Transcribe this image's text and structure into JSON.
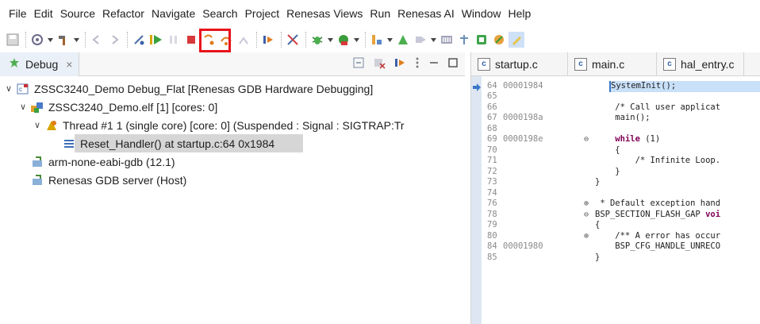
{
  "menu": [
    "File",
    "Edit",
    "Source",
    "Refactor",
    "Navigate",
    "Search",
    "Project",
    "Renesas Views",
    "Run",
    "Renesas AI",
    "Window",
    "Help"
  ],
  "debug": {
    "tab_label": "Debug",
    "tab_close": "×",
    "tree": [
      {
        "level": 0,
        "twisty": "∨",
        "icon": "launch-config-icon",
        "label": "ZSSC3240_Demo Debug_Flat [Renesas GDB Hardware Debugging]"
      },
      {
        "level": 1,
        "twisty": "∨",
        "icon": "elf-process-icon",
        "label": "ZSSC3240_Demo.elf [1] [cores: 0]"
      },
      {
        "level": 2,
        "twisty": "∨",
        "icon": "thread-suspended-icon",
        "label": "Thread #1 1 (single core) [core: 0] (Suspended : Signal : SIGTRAP:Tr"
      },
      {
        "level": 3,
        "twisty": "",
        "icon": "stack-frame-icon",
        "label": "Reset_Handler() at startup.c:64 0x1984",
        "selected": true
      },
      {
        "level": 1,
        "twisty": "",
        "icon": "gdb-process-icon",
        "label": "arm-none-eabi-gdb (12.1)"
      },
      {
        "level": 1,
        "twisty": "",
        "icon": "gdb-server-icon",
        "label": "Renesas GDB server (Host)"
      }
    ]
  },
  "editor": {
    "tabs": [
      "startup.c",
      "main.c",
      "hal_entry.c"
    ],
    "lines": [
      {
        "ln": "64",
        "addr": "00001984",
        "fold": "",
        "text": "SystemInit();",
        "current": true
      },
      {
        "ln": "65",
        "addr": "",
        "fold": "",
        "text": ""
      },
      {
        "ln": "66",
        "addr": "",
        "fold": "",
        "text": "    /* Call user applicat",
        "cls": "cm"
      },
      {
        "ln": "67",
        "addr": "0000198a",
        "fold": "",
        "text": "    main();"
      },
      {
        "ln": "68",
        "addr": "",
        "fold": "",
        "text": ""
      },
      {
        "ln": "69",
        "addr": "0000198e",
        "fold": "⊖",
        "text": "    while (1)",
        "kw": "while"
      },
      {
        "ln": "70",
        "addr": "",
        "fold": "",
        "text": "    {"
      },
      {
        "ln": "71",
        "addr": "",
        "fold": "",
        "text": "        /* Infinite Loop.",
        "cls": "cm"
      },
      {
        "ln": "72",
        "addr": "",
        "fold": "",
        "text": "    }"
      },
      {
        "ln": "73",
        "addr": "",
        "fold": "",
        "text": "}"
      },
      {
        "ln": "74",
        "addr": "",
        "fold": "",
        "text": ""
      },
      {
        "ln": "76",
        "addr": "",
        "fold": "⊕",
        "text": " * Default exception hand",
        "cls": "cm"
      },
      {
        "ln": "78",
        "addr": "",
        "fold": "⊖",
        "text": "BSP_SECTION_FLASH_GAP voi",
        "kw": "voi"
      },
      {
        "ln": "79",
        "addr": "",
        "fold": "",
        "text": "{"
      },
      {
        "ln": "80",
        "addr": "",
        "fold": "⊕",
        "text": "    /** A error has occur",
        "cls": "cm"
      },
      {
        "ln": "84",
        "addr": "00001980",
        "fold": "",
        "text": "    BSP_CFG_HANDLE_UNRECO"
      },
      {
        "ln": "85",
        "addr": "",
        "fold": "",
        "text": "}"
      }
    ]
  },
  "colors": {
    "highlight_box": "#e8141b",
    "current_line": "#c8e0f8",
    "selected_row": "#d6d6d6"
  }
}
